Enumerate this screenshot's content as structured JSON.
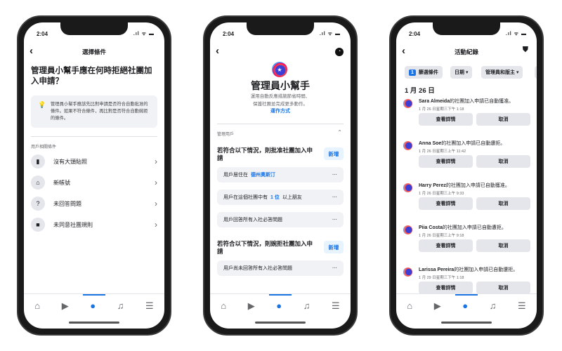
{
  "status": {
    "time": "2:04",
    "signal": ".ıl ᯤ ▬"
  },
  "phone1": {
    "title": "選擇條件",
    "question": "管理員小幫手應在何時拒絕社團加入申請？",
    "info": "管理員小幫手應該先比對申請是否符合自動批准的條件。如果不符合條件，再比對是否符合自動婉拒的條件。",
    "section": "用戶相關條件",
    "items": [
      {
        "label": "沒有大頭貼照",
        "icon": "▮"
      },
      {
        "label": "新帳號",
        "icon": "⌂"
      },
      {
        "label": "未回答問題",
        "icon": "?"
      },
      {
        "label": "未同意社團規則",
        "icon": "■"
      }
    ]
  },
  "phone2": {
    "title": "管理員小幫手",
    "desc1": "運用自動反應措施節省時間、",
    "desc2": "保護社團並完成更多動作。",
    "link": "運作方式",
    "section": "管理用戶",
    "approve_heading": "若符合以下情況，則批准社團加入申請",
    "add_label": "新增",
    "approve_rules": [
      {
        "pre": "用戶居住在",
        "val": "德州奧斯汀",
        "post": ""
      },
      {
        "pre": "用戶在這個社團中有",
        "val": "1 位",
        "post": "以上朋友"
      },
      {
        "pre": "用戶回答所有入社必答問題",
        "val": "",
        "post": ""
      }
    ],
    "decline_heading": "若符合以下情況，則婉拒社團加入申請",
    "decline_rules": [
      {
        "pre": "用戶尚未回答所有入社必答問題"
      }
    ]
  },
  "phone3": {
    "title": "活動紀錄",
    "filters": {
      "count": "1",
      "filter_label": "篩選條件",
      "date": "日期 ▾",
      "admins": "管理員和版主 ▾"
    },
    "date_heading": "1 月 26 日",
    "view_label": "查看詳情",
    "cancel_label": "取消",
    "entries": [
      {
        "name": "Sara Almeida",
        "msg": "的社團加入申請已自動獲准。",
        "time": "1 月 26 日星期三下午 1:18"
      },
      {
        "name": "Anna Soe",
        "msg": "的社團加入申請已自動遭拒。",
        "time": "1 月 26 日星期三上午 11:42"
      },
      {
        "name": "Harry Perez",
        "msg": "的社團加入申請已自動獲准。",
        "time": "1 月 26 日星期三上午 9:33"
      },
      {
        "name": "Piia Costa",
        "msg": "的社團加入申請已自動遭拒。",
        "time": "1 月 26 日星期三上午 9:18"
      },
      {
        "name": "Larissa Pereira",
        "msg": "的社團加入申請已自動遭拒。",
        "time": "1 月 29 日星期三下午 1:18"
      }
    ]
  },
  "colors": {
    "accent": "#1b74e4",
    "chip": "#e4e6eb",
    "panel": "#f0f2f5"
  }
}
